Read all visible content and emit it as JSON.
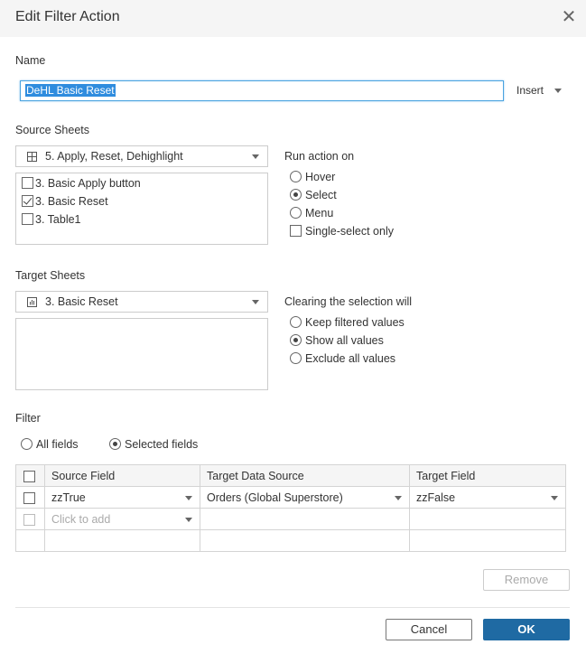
{
  "dialog": {
    "title": "Edit Filter Action",
    "close_icon": "close-icon"
  },
  "name_section": {
    "label": "Name",
    "value": "DeHL Basic Reset",
    "insert_label": "Insert"
  },
  "source_sheets": {
    "label": "Source Sheets",
    "dropdown_value": "5. Apply, Reset, Dehighlight",
    "dropdown_icon": "dashboard-icon",
    "items": [
      {
        "label": "3. Basic Apply button",
        "checked": false
      },
      {
        "label": "3. Basic Reset",
        "checked": true
      },
      {
        "label": "3. Table1",
        "checked": false
      }
    ]
  },
  "run_action_on": {
    "label": "Run action on",
    "options": [
      {
        "label": "Hover",
        "selected": false
      },
      {
        "label": "Select",
        "selected": true
      },
      {
        "label": "Menu",
        "selected": false
      }
    ],
    "single_select_label": "Single-select only",
    "single_select_checked": false
  },
  "target_sheets": {
    "label": "Target Sheets",
    "dropdown_value": "3. Basic Reset",
    "dropdown_icon": "bar-chart-icon"
  },
  "clearing": {
    "label": "Clearing the selection will",
    "options": [
      {
        "label": "Keep filtered values",
        "selected": false
      },
      {
        "label": "Show all values",
        "selected": true
      },
      {
        "label": "Exclude all values",
        "selected": false
      }
    ]
  },
  "filter": {
    "label": "Filter",
    "scope_options": [
      {
        "label": "All fields",
        "selected": false
      },
      {
        "label": "Selected fields",
        "selected": true
      }
    ],
    "columns": [
      "Source Field",
      "Target Data Source",
      "Target Field"
    ],
    "rows": [
      {
        "source_field": "zzTrue",
        "target_data_source": "Orders (Global Superstore)",
        "target_field": "zzFalse"
      }
    ],
    "add_placeholder": "Click to add"
  },
  "buttons": {
    "remove": "Remove",
    "cancel": "Cancel",
    "ok": "OK"
  },
  "colors": {
    "accent": "#1f6aa3",
    "selection": "#2f8cde",
    "focus_border": "#4aa3e0"
  }
}
